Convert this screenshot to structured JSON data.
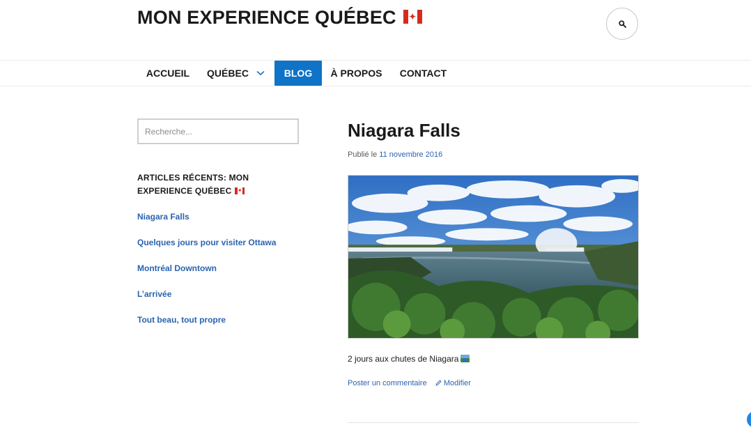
{
  "site": {
    "title": "MON EXPERIENCE QUÉBEC",
    "flag_icon": "canada-flag-icon"
  },
  "header": {
    "search_toggle_icon": "search-icon"
  },
  "nav": {
    "items": [
      {
        "label": "ACCUEIL",
        "active": false
      },
      {
        "label": "QUÉBEC",
        "active": false,
        "has_submenu": true
      },
      {
        "label": "BLOG",
        "active": true
      },
      {
        "label": "À PROPOS",
        "active": false
      },
      {
        "label": "CONTACT",
        "active": false
      }
    ],
    "active_color": "#0f73c7"
  },
  "sidebar": {
    "search_placeholder": "Recherche...",
    "recent_title": "ARTICLES RÉCENTS: MON EXPERIENCE QUÉBEC",
    "recent_posts": [
      "Niagara Falls",
      "Quelques jours pour visiter Ottawa",
      "Montréal Downtown",
      "L’arrivée",
      "Tout beau, tout propre"
    ]
  },
  "post": {
    "title": "Niagara Falls",
    "meta_prefix": "Publié le",
    "date": "11 novembre 2016",
    "image_icon": "niagara-falls-photo",
    "excerpt": "2 jours aux chutes de Niagara",
    "comment_link": "Poster un commentaire",
    "edit_link": "Modifier"
  },
  "colors": {
    "link": "#2b63b0",
    "accent": "#0f73c7",
    "text": "#1a1a1a"
  }
}
